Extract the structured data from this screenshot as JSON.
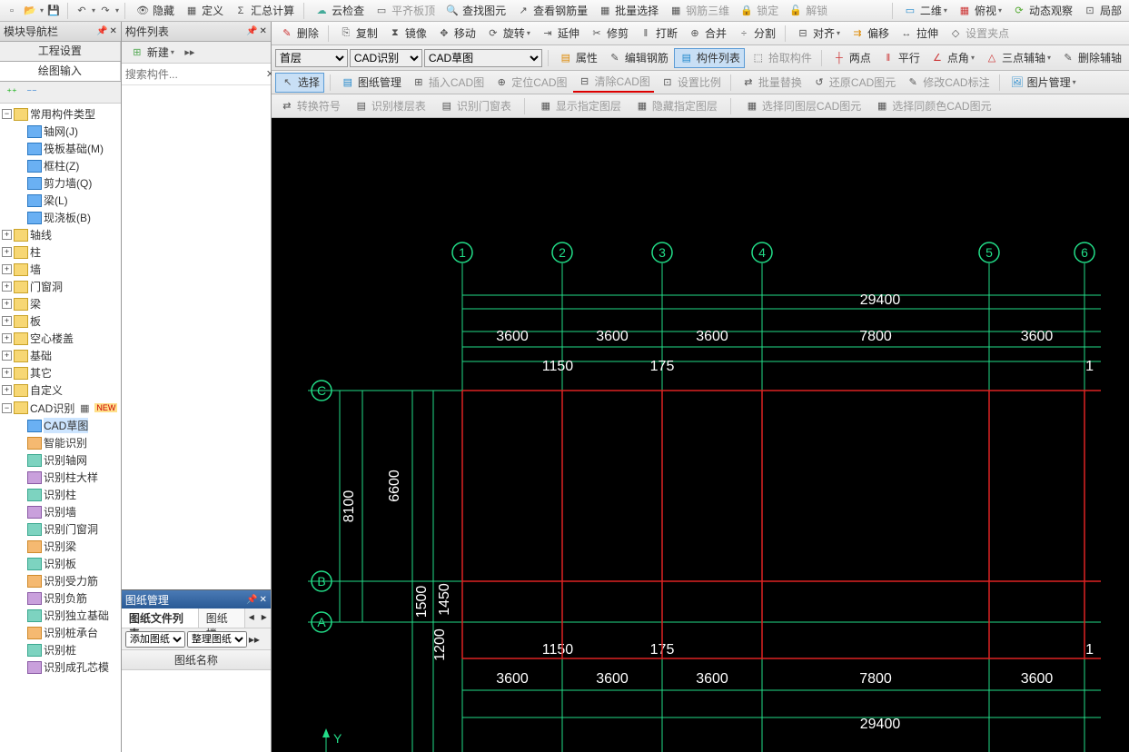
{
  "topbar": {
    "hide": "隐藏",
    "define": "定义",
    "sum": "汇总计算",
    "cloud": "云检查",
    "flat": "平齐板顶",
    "findtu": "查找图元",
    "rebar": "查看钢筋量",
    "batchsel": "批量选择",
    "rebar3d": "钢筋三维",
    "lock": "锁定",
    "unlock": "解锁",
    "view2d": "二维",
    "overlook": "俯视",
    "dynobs": "动态观察",
    "local": "局部"
  },
  "toolbar2": {
    "delete": "删除",
    "copy": "复制",
    "mirror": "镜像",
    "move": "移动",
    "rotate": "旋转",
    "extend": "延伸",
    "trim": "修剪",
    "break": "打断",
    "merge": "合并",
    "split": "分割",
    "align": "对齐",
    "offset": "偏移",
    "stretch": "拉伸",
    "setgrip": "设置夹点"
  },
  "toolbar3": {
    "floor": "首层",
    "cadrec": "CAD识别",
    "cadsketch": "CAD草图",
    "attr": "属性",
    "editrebar": "编辑钢筋",
    "complist": "构件列表",
    "pickcomp": "拾取构件",
    "twopt": "两点",
    "parallel": "平行",
    "ptangle": "点角",
    "threeptaux": "三点辅轴",
    "delaux": "删除辅轴"
  },
  "toolbar4": {
    "select": "选择",
    "picmgr": "图纸管理",
    "insertcad": "插入CAD图",
    "locatecad": "定位CAD图",
    "clearcad": "清除CAD图",
    "setscale": "设置比例",
    "batchrep": "批量替换",
    "restorecad": "还原CAD图元",
    "modcadlabel": "修改CAD标注",
    "picmgr2": "图片管理"
  },
  "toolbar5": {
    "convsym": "转换符号",
    "recfloor": "识别楼层表",
    "recdoor": "识别门窗表",
    "showlayer": "显示指定图层",
    "hidelayer": "隐藏指定图层",
    "sellayer": "选择同图层CAD图元",
    "selcolor": "选择同颜色CAD图元"
  },
  "nav": {
    "title": "模块导航栏",
    "tab1": "工程设置",
    "tab2": "绘图输入",
    "common": "常用构件类型",
    "items_common": [
      {
        "l": "轴网(J)"
      },
      {
        "l": "筏板基础(M)"
      },
      {
        "l": "框柱(Z)"
      },
      {
        "l": "剪力墙(Q)"
      },
      {
        "l": "梁(L)"
      },
      {
        "l": "现浇板(B)"
      }
    ],
    "cats": [
      "轴线",
      "柱",
      "墙",
      "门窗洞",
      "梁",
      "板",
      "空心楼盖",
      "基础",
      "其它",
      "自定义"
    ],
    "cadrec": "CAD识别",
    "new": "NEW",
    "cad_items": [
      "CAD草图",
      "智能识别",
      "识别轴网",
      "识别柱大样",
      "识别柱",
      "识别墙",
      "识别门窗洞",
      "识别梁",
      "识别板",
      "识别受力筋",
      "识别负筋",
      "识别独立基础",
      "识别桩承台",
      "识别桩",
      "识别成孔芯模"
    ]
  },
  "complist": {
    "title": "构件列表",
    "new": "新建",
    "search_ph": "搜索构件..."
  },
  "drawmgr": {
    "title": "图纸管理",
    "tab1": "图纸文件列表",
    "tab2": "图纸楼",
    "add": "添加图纸",
    "arrange": "整理图纸",
    "colname": "图纸名称"
  },
  "canvas": {
    "axes_h": [
      "1",
      "2",
      "3",
      "4",
      "5",
      "6"
    ],
    "axes_v": [
      "A",
      "B",
      "C"
    ],
    "dims_top": [
      "3600",
      "3600",
      "3600",
      "7800",
      "3600"
    ],
    "total": "29400",
    "dims_mid": [
      "1150",
      "175"
    ],
    "dims_mid_r": "1",
    "v_dims": [
      "8100",
      "6600",
      "1450",
      "1500",
      "1200"
    ],
    "y_label": "Y"
  }
}
